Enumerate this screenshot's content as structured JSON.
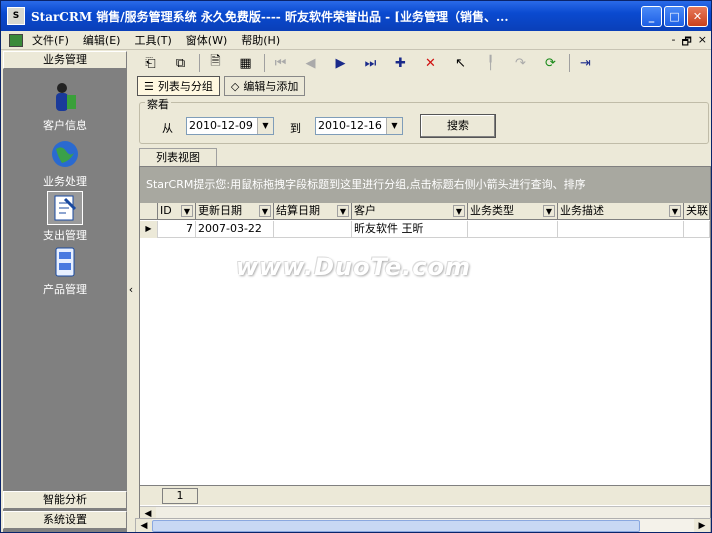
{
  "window": {
    "title": "StarCRM 销售/服务管理系统 永久免费版---- 昕友软件荣誉出品  - [业务管理（销售、...",
    "min_label": "_",
    "max_label": "□",
    "close_label": "✕"
  },
  "menu": {
    "items": [
      "文件(F)",
      "编辑(E)",
      "工具(T)",
      "窗体(W)",
      "帮助(H)"
    ],
    "mdi": [
      "-",
      "🗗",
      "×"
    ]
  },
  "sidebar": {
    "header": "业务管理",
    "items": [
      {
        "label": "客户信息",
        "icon": "customer-person-icon"
      },
      {
        "label": "业务处理",
        "icon": "globe-icon"
      },
      {
        "label": "支出管理",
        "icon": "expense-document-icon"
      },
      {
        "label": "产品管理",
        "icon": "product-cabinet-icon"
      }
    ],
    "bottom": [
      "智能分析",
      "系统设置"
    ],
    "collapse_arrow": "‹"
  },
  "toolbar": {
    "icons": [
      "import-icon",
      "export-icon",
      "report-icon",
      "grid-icon",
      "first-icon",
      "prev-icon",
      "next-icon",
      "last-icon",
      "add-icon",
      "delete-icon",
      "pointer-icon",
      "pin-icon",
      "undo-icon",
      "refresh-icon",
      "exit-icon"
    ],
    "glyphs": [
      "⎗",
      "⧉",
      "🗎",
      "▦",
      "⏮",
      "◀",
      "▶",
      "⏭",
      "✚",
      "✕",
      "↖",
      "╿",
      "↷",
      "⟳",
      "⇥"
    ]
  },
  "tabs": [
    {
      "label": "列表与分组",
      "active": true
    },
    {
      "label": "编辑与添加",
      "active": false
    }
  ],
  "filter": {
    "legend": "察看",
    "from_label": "从",
    "from_date": "2010-12-09",
    "to_label": "到",
    "to_date": "2010-12-16",
    "search_label": "搜索"
  },
  "view_tab": "列表视图",
  "grid": {
    "group_hint": "StarCRM提示您:用鼠标拖拽字段标题到这里进行分组,点击标题右侧小箭头进行查询、排序",
    "columns": [
      "ID",
      "更新日期",
      "结算日期",
      "客户",
      "业务类型",
      "业务描述",
      "关联"
    ],
    "rows": [
      [
        "7",
        "2007-03-22",
        "",
        "昕友软件 王昕",
        "",
        "",
        ""
      ]
    ],
    "row_count": "1"
  },
  "watermark": "www.DuoTe.com"
}
